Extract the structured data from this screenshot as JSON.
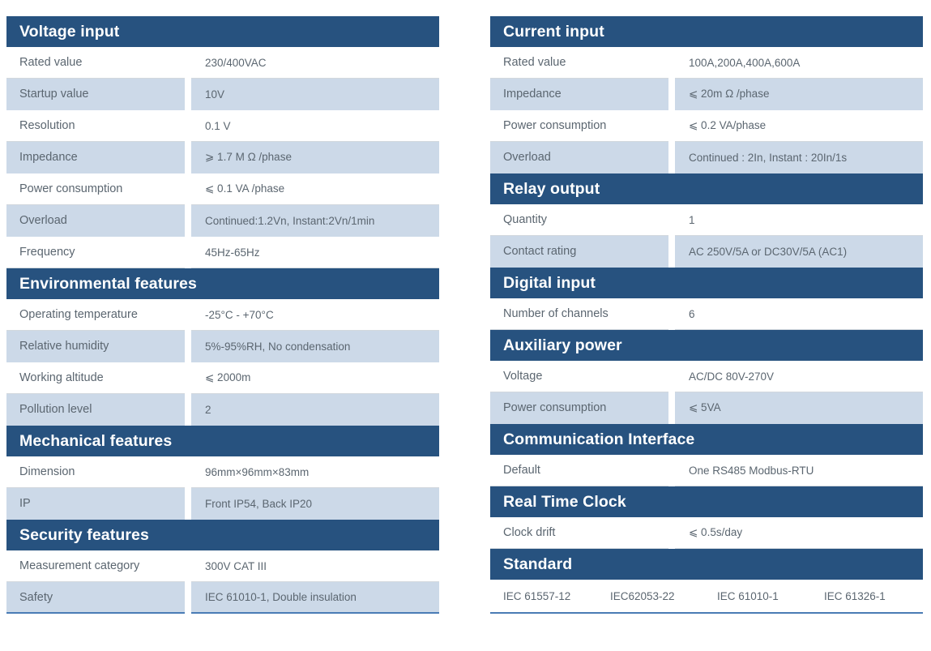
{
  "colors": {
    "header_blue": "#27527f",
    "row_shaded": "#ccd9e8",
    "row_plain": "#ffffff",
    "text_gray": "#5b6670",
    "baseline_blue": "#4a7cb5"
  },
  "left_column": [
    {
      "type": "section",
      "title": "Voltage input",
      "rows": [
        {
          "label": "Rated value",
          "value": "230/400VAC"
        },
        {
          "label": "Startup value",
          "value": "10V"
        },
        {
          "label": "Resolution",
          "value": "0.1 V"
        },
        {
          "label": "Impedance",
          "value": "⩾ 1.7 M Ω /phase"
        },
        {
          "label": "Power consumption",
          "value": "⩽ 0.1 VA /phase"
        },
        {
          "label": "Overload",
          "value": "Continued:1.2Vn, Instant:2Vn/1min"
        },
        {
          "label": "Frequency",
          "value": "45Hz-65Hz"
        }
      ]
    },
    {
      "type": "section",
      "title": "Environmental features",
      "rows": [
        {
          "label": "Operating temperature",
          "value": "-25°C - +70°C"
        },
        {
          "label": "Relative humidity",
          "value": "5%-95%RH, No condensation"
        },
        {
          "label": "Working altitude",
          "value": "⩽ 2000m"
        },
        {
          "label": "Pollution level",
          "value": "2"
        }
      ]
    },
    {
      "type": "section",
      "title": "Mechanical features",
      "rows": [
        {
          "label": "Dimension",
          "value": "96mm×96mm×83mm"
        },
        {
          "label": "IP",
          "value": "Front IP54, Back IP20"
        }
      ]
    },
    {
      "type": "section",
      "title": "Security features",
      "rows": [
        {
          "label": "Measurement category",
          "value": "300V CAT III"
        },
        {
          "label": "Safety",
          "value": "IEC 61010-1, Double insulation"
        }
      ]
    }
  ],
  "right_column": [
    {
      "type": "section",
      "title": "Current input",
      "rows": [
        {
          "label": "Rated value",
          "value": "100A,200A,400A,600A"
        },
        {
          "label": "Impedance",
          "value": "⩽ 20m Ω /phase"
        },
        {
          "label": "Power consumption",
          "value": "⩽ 0.2 VA/phase"
        },
        {
          "label": "Overload",
          "value": "Continued : 2In, Instant : 20In/1s"
        }
      ]
    },
    {
      "type": "section",
      "title": "Relay output",
      "rows": [
        {
          "label": "Quantity",
          "value": "1"
        },
        {
          "label": "Contact rating",
          "value": "AC 250V/5A or DC30V/5A (AC1)"
        }
      ]
    },
    {
      "type": "section",
      "title": "Digital input",
      "rows": [
        {
          "label": "Number of channels",
          "value": "6"
        }
      ]
    },
    {
      "type": "section",
      "title": "Auxiliary power",
      "rows": [
        {
          "label": "Voltage",
          "value": "AC/DC 80V-270V"
        },
        {
          "label": "Power consumption",
          "value": "⩽ 5VA"
        }
      ]
    },
    {
      "type": "section",
      "title": "Communication Interface",
      "rows": [
        {
          "label": "Default",
          "value": "One RS485  Modbus-RTU"
        }
      ]
    },
    {
      "type": "section",
      "title": "Real Time Clock",
      "rows": [
        {
          "label": "Clock drift",
          "value": "⩽ 0.5s/day"
        }
      ]
    },
    {
      "type": "section",
      "title": "Standard",
      "standards": [
        "IEC 61557-12",
        "IEC62053-22",
        "IEC 61010-1",
        "IEC 61326-1"
      ]
    }
  ]
}
